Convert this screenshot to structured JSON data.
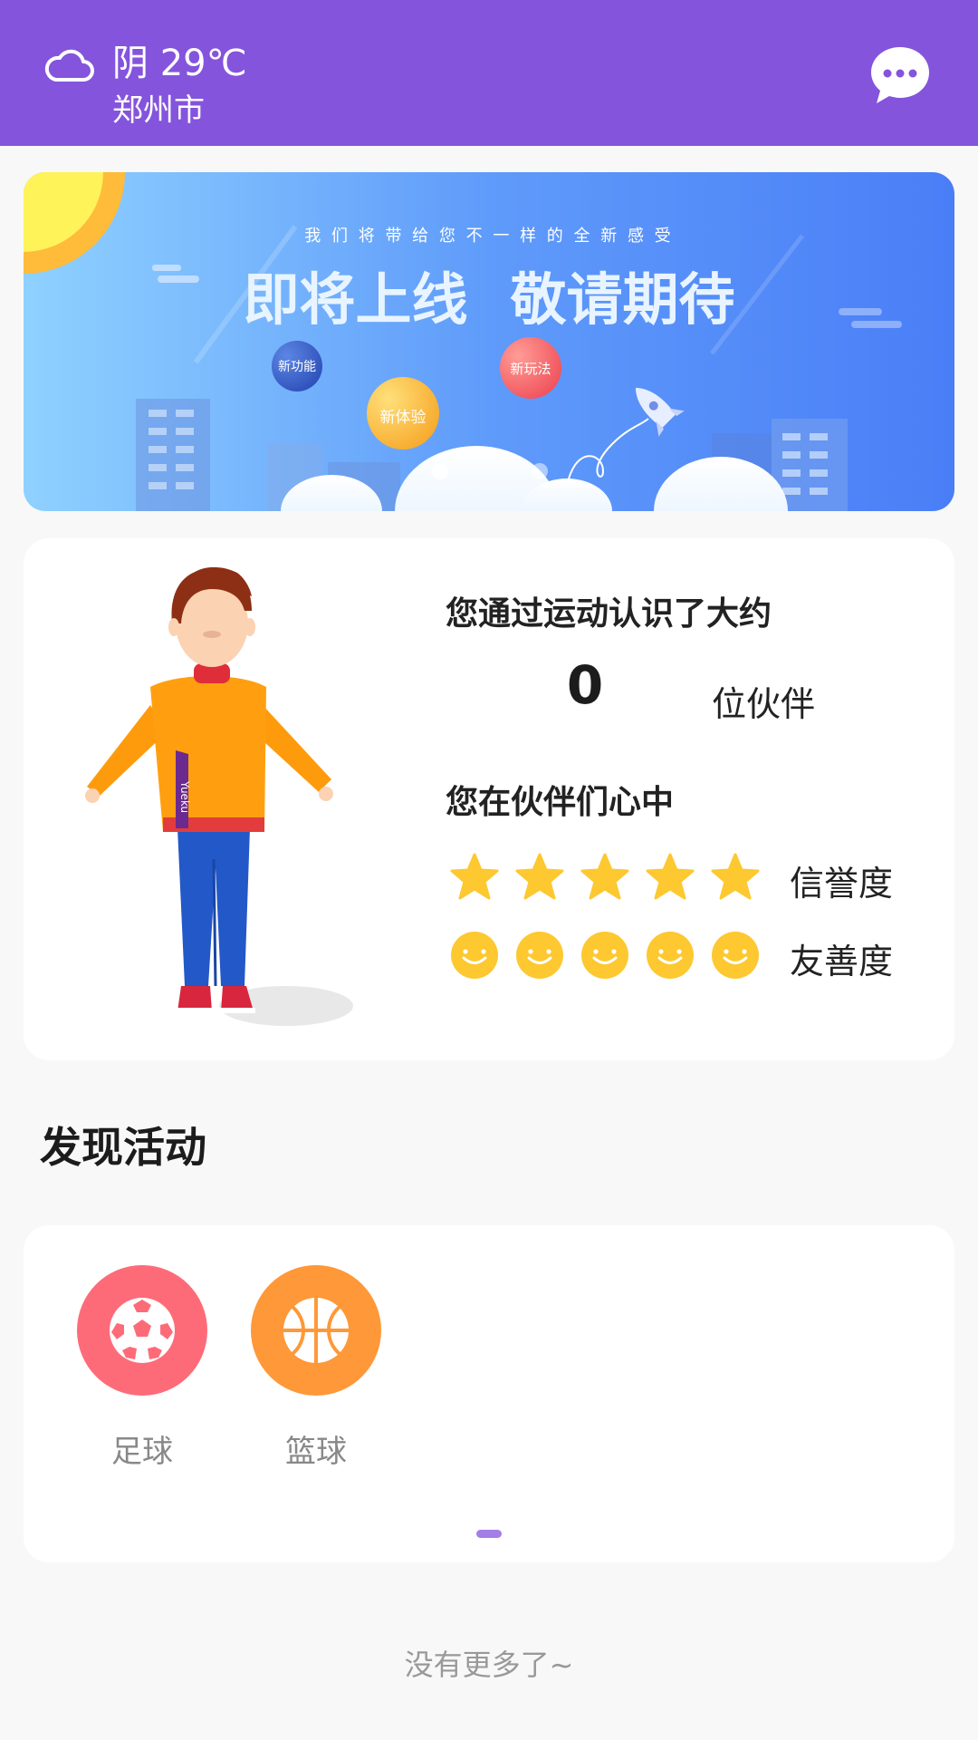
{
  "header": {
    "weather": "阴 29℃",
    "city": "郑州市",
    "weather_icon": "cloud-icon",
    "chat_icon": "chat-bubble-icon",
    "background_color": "#8454dd"
  },
  "banner": {
    "subtitle": "我 们 将 带 给 您 不 一 样 的 全 新 感 受",
    "title_left": "即将上线",
    "title_right": "敬请期待",
    "bubble_1": "新功能",
    "bubble_2": "新玩法",
    "bubble_3": "新体验"
  },
  "profile": {
    "intro_text": "您通过运动认识了大约",
    "partners_count": "0",
    "partners_unit": "位伙伴",
    "heart_text": "您在伙伴们心中",
    "credit_label": "信誉度",
    "credit_rating": 5,
    "friendly_label": "友善度",
    "friendly_rating": 5,
    "avatar_text": "Yueku"
  },
  "activities": {
    "title": "发现活动",
    "items": [
      {
        "label": "足球",
        "icon": "soccer-ball-icon",
        "color": "#fe6b78"
      },
      {
        "label": "篮球",
        "icon": "basketball-icon",
        "color": "#fe9838"
      }
    ]
  },
  "footer": {
    "no_more": "没有更多了~"
  }
}
